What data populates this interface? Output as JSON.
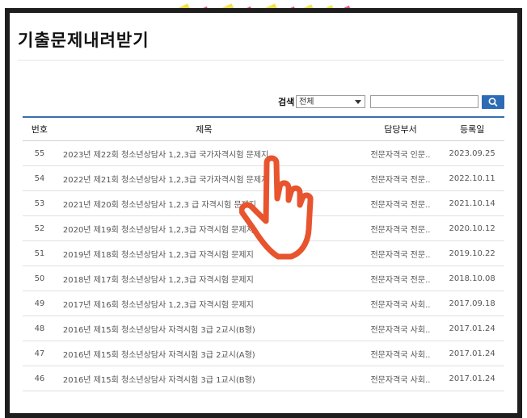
{
  "page": {
    "title": "기출문제내려받기"
  },
  "search": {
    "label": "검색",
    "select_value": "전체",
    "input_value": ""
  },
  "table": {
    "headers": {
      "num": "번호",
      "title": "제목",
      "dept": "담당부서",
      "date": "등록일"
    },
    "rows": [
      {
        "num": "55",
        "title": "2023년 제22회 청소년상담사 1,2,3급 국가자격시험 문제지",
        "dept": "전문자격국 인문..",
        "date": "2023.09.25"
      },
      {
        "num": "54",
        "title": "2022년 제21회 청소년상담사 1,2,3급 국가자격시험 문제지",
        "dept": "전문자격국 전문..",
        "date": "2022.10.11"
      },
      {
        "num": "53",
        "title": "2021년 제20회 청소년상담사 1,2,3 급 자격시험 문제지",
        "dept": "전문자격국 전문..",
        "date": "2021.10.14"
      },
      {
        "num": "52",
        "title": "2020년 제19회 청소년상담사 1,2,3급 자격시험 문제지",
        "dept": "전문자격국 전문..",
        "date": "2020.10.12"
      },
      {
        "num": "51",
        "title": "2019년 제18회 청소년상담사 1,2,3급 자격시험 문제지",
        "dept": "전문자격국 전문..",
        "date": "2019.10.22"
      },
      {
        "num": "50",
        "title": "2018년 제17회 청소년상담사 1,2,3급 자격시험 문제지",
        "dept": "전문자격국 전문..",
        "date": "2018.10.08"
      },
      {
        "num": "49",
        "title": "2017년 제16회 청소년상담사 1,2,3급 자격시험 문제지",
        "dept": "전문자격국 사회..",
        "date": "2017.09.18"
      },
      {
        "num": "48",
        "title": "2016년 제15회 청소년상담사 자격시험 3급 2교시(B형)",
        "dept": "전문자격국 사회..",
        "date": "2017.01.24"
      },
      {
        "num": "47",
        "title": "2016년 제15회 청소년상담사 자격시험 3급 2교시(A형)",
        "dept": "전문자격국 사회..",
        "date": "2017.01.24"
      },
      {
        "num": "46",
        "title": "2016년 제15회 청소년상담사 자격시험 3급 1교시(B형)",
        "dept": "전문자격국 사회..",
        "date": "2017.01.24"
      }
    ]
  },
  "colors": {
    "frame": "#1e1e1e",
    "accent": "#2d6bb5",
    "hand_stroke": "#e8542e",
    "tape_yellow": "#f2e14c",
    "tape_pink": "#e85a8c"
  },
  "icons": {
    "search_button": "search-icon",
    "pointer": "pointing-hand-icon"
  }
}
